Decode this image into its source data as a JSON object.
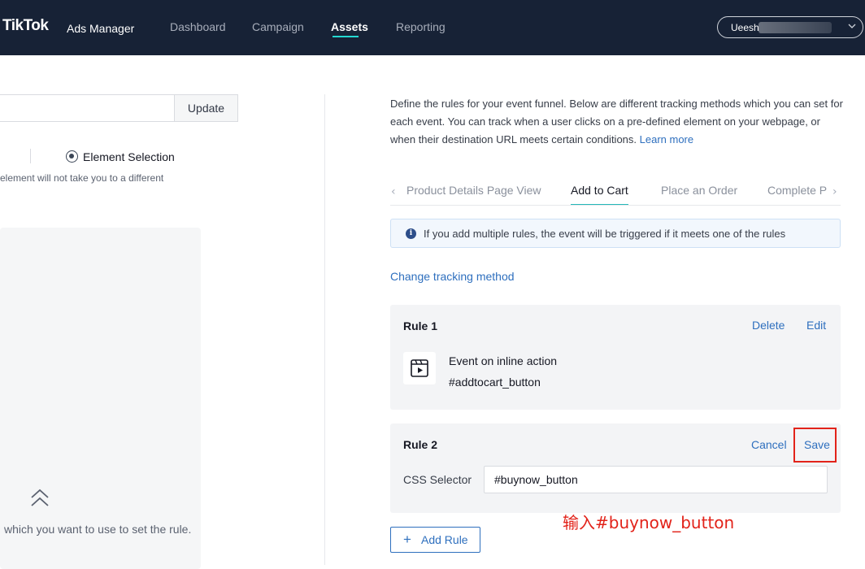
{
  "header": {
    "logo": "TikTok",
    "logo_sub": "Ads Manager",
    "nav": [
      "Dashboard",
      "Campaign",
      "Assets",
      "Reporting"
    ],
    "active_nav": "Assets",
    "account_name": "Ueesh"
  },
  "left_panel": {
    "update_label": "Update",
    "radio_label": "Element Selection",
    "hint": "element will not take you to a different",
    "bottom_text": "which you want to use to set the rule."
  },
  "right_panel": {
    "description": "Define the rules for your event funnel. Below are different tracking methods which you can set for each event. You can track when a user clicks on a pre-defined element on your webpage, or when their destination URL meets certain conditions.",
    "learn_more": "Learn more",
    "tabs": [
      "Product Details Page View",
      "Add to Cart",
      "Place an Order",
      "Complete Payment"
    ],
    "active_tab": "Add to Cart",
    "info": "If you add multiple rules, the event will be triggered if it meets one of the rules",
    "change_tracking": "Change tracking method",
    "rule1": {
      "title": "Rule 1",
      "delete": "Delete",
      "edit": "Edit",
      "line1": "Event on inline action",
      "line2": "#addtocart_button"
    },
    "rule2": {
      "title": "Rule 2",
      "cancel": "Cancel",
      "save": "Save",
      "css_label": "CSS Selector",
      "css_value": "#buynow_button"
    },
    "add_rule": "Add Rule",
    "annotation": "输入#buynow_button"
  },
  "colors": {
    "nav_bg": "#172236",
    "accent_teal": "#25b8b8",
    "link_blue": "#2e6fbe",
    "highlight_red": "#e2231a"
  },
  "icons": [
    "chevron-down-icon",
    "chevron-left-icon",
    "chevron-right-icon",
    "info-icon",
    "video-play-icon",
    "double-chevron-up-icon",
    "plus-icon"
  ]
}
